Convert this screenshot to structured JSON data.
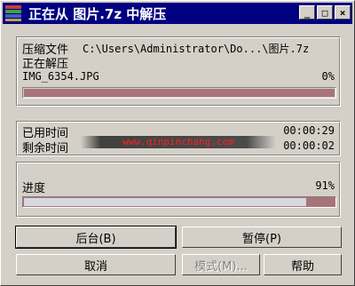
{
  "titlebar": {
    "title": "正在从 图片.7z 中解压",
    "minimize": "_",
    "maximize": "□",
    "close": "×"
  },
  "file_group": {
    "archive_label": "压缩文件",
    "archive_path": "C:\\Users\\Administrator\\Do...\\图片.7z",
    "status_label": "正在解压",
    "current_file": "IMG_6354.JPG",
    "file_percent": "0%",
    "file_progress": 0
  },
  "time_group": {
    "elapsed_label": "已用时间",
    "elapsed_value": "00:00:29",
    "remaining_label": "剩余时间",
    "remaining_value": "00:00:02",
    "watermark": "www.qinpinchang.com"
  },
  "progress_group": {
    "label": "进度",
    "percent_text": "91%",
    "progress": 0.91
  },
  "buttons": {
    "background": "后台(B)",
    "pause": "暂停(P)",
    "cancel": "取消",
    "mode": "模式(M)...",
    "help": "帮助"
  },
  "colors": {
    "titlebar": "#000080",
    "progress_fill": "#a8747a",
    "face": "#d4d0c8"
  }
}
